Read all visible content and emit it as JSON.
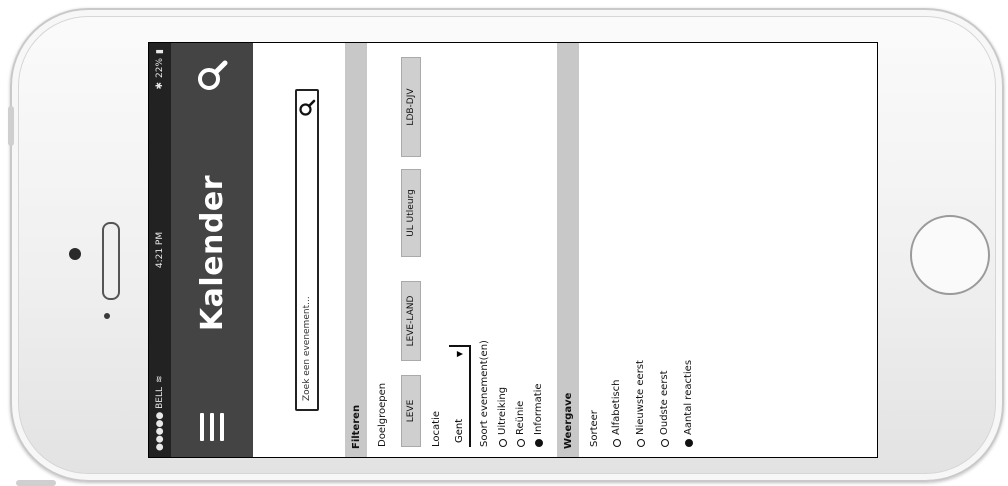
{
  "status_bar": {
    "carrier": "●●●●● BELL",
    "time": "4:21 PM",
    "battery": "22%"
  },
  "app_bar": {
    "title": "Kalender"
  },
  "search": {
    "placeholder": "Zoek een evenement..."
  },
  "filters": {
    "section_title": "Filteren",
    "groups_label": "Doelgroepen",
    "chips": [
      "LEVE",
      "LEVE-LAND",
      "UL Utleurg",
      "LDB-DJV"
    ],
    "location_label": "Locatie",
    "location_value": "Gent",
    "type_label": "Soort evenement(en)",
    "type_options": [
      {
        "label": "Uitreiking",
        "checked": false
      },
      {
        "label": "Reünie",
        "checked": false
      },
      {
        "label": "Informatie",
        "checked": true
      }
    ]
  },
  "view": {
    "section_title": "Weergave",
    "sort_label": "Sorteer",
    "options": [
      {
        "label": "Alfabetisch",
        "selected": false
      },
      {
        "label": "Nieuwste eerst",
        "selected": false
      },
      {
        "label": "Oudste eerst",
        "selected": false
      },
      {
        "label": "Aantal reacties",
        "selected": true
      }
    ]
  }
}
